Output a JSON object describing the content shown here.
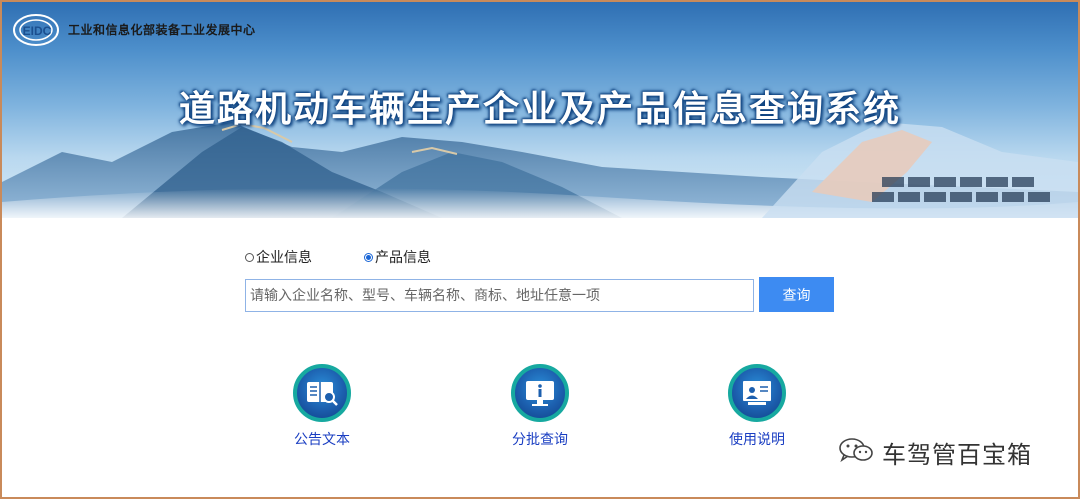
{
  "banner": {
    "org_name": "工业和信息化部装备工业发展中心",
    "logo_text": "EIDC",
    "system_title": "道路机动车辆生产企业及产品信息查询系统"
  },
  "search": {
    "options": [
      {
        "label": "企业信息",
        "checked": false
      },
      {
        "label": "产品信息",
        "checked": true
      }
    ],
    "placeholder": "请输入企业名称、型号、车辆名称、商标、地址任意一项",
    "value": "",
    "button_label": "查询"
  },
  "quick_links": [
    {
      "label": "公告文本",
      "icon": "book-search-icon"
    },
    {
      "label": "分批查询",
      "icon": "info-monitor-icon"
    },
    {
      "label": "使用说明",
      "icon": "presentation-icon"
    }
  ],
  "watermark": {
    "text": "车驾管百宝箱",
    "icon": "wechat-icon"
  },
  "colors": {
    "accent": "#3d8bf2",
    "link": "#1a3ec2",
    "border": "#c98a5a"
  }
}
